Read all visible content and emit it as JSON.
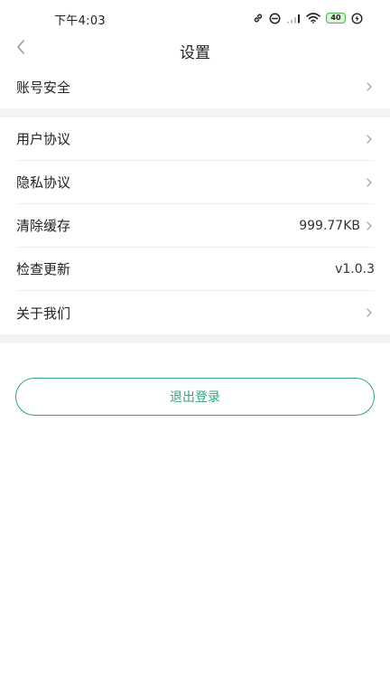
{
  "status_bar": {
    "time": "下午4:03",
    "battery": "40"
  },
  "header": {
    "title": "设置"
  },
  "sections": [
    {
      "items": [
        {
          "label": "账号安全",
          "value": "",
          "arrow": true
        }
      ]
    },
    {
      "items": [
        {
          "label": "用户协议",
          "value": "",
          "arrow": true
        },
        {
          "label": "隐私协议",
          "value": "",
          "arrow": true
        },
        {
          "label": "清除缓存",
          "value": "999.77KB",
          "arrow": true
        },
        {
          "label": "检查更新",
          "value": "v1.0.3",
          "arrow": false
        },
        {
          "label": "关于我们",
          "value": "",
          "arrow": true
        }
      ]
    }
  ],
  "logout_label": "退出登录",
  "colors": {
    "accent": "#35a67b",
    "divider": "#eeeeee",
    "section_gap": "#f3f3f3",
    "battery": "#4caf50"
  },
  "icons": {
    "back": "chevron-left-icon",
    "row_arrow": "chevron-right-icon",
    "status": [
      "link-icon",
      "do-not-disturb-icon",
      "signal-icon",
      "wifi-icon",
      "battery-icon",
      "charging-icon"
    ]
  }
}
